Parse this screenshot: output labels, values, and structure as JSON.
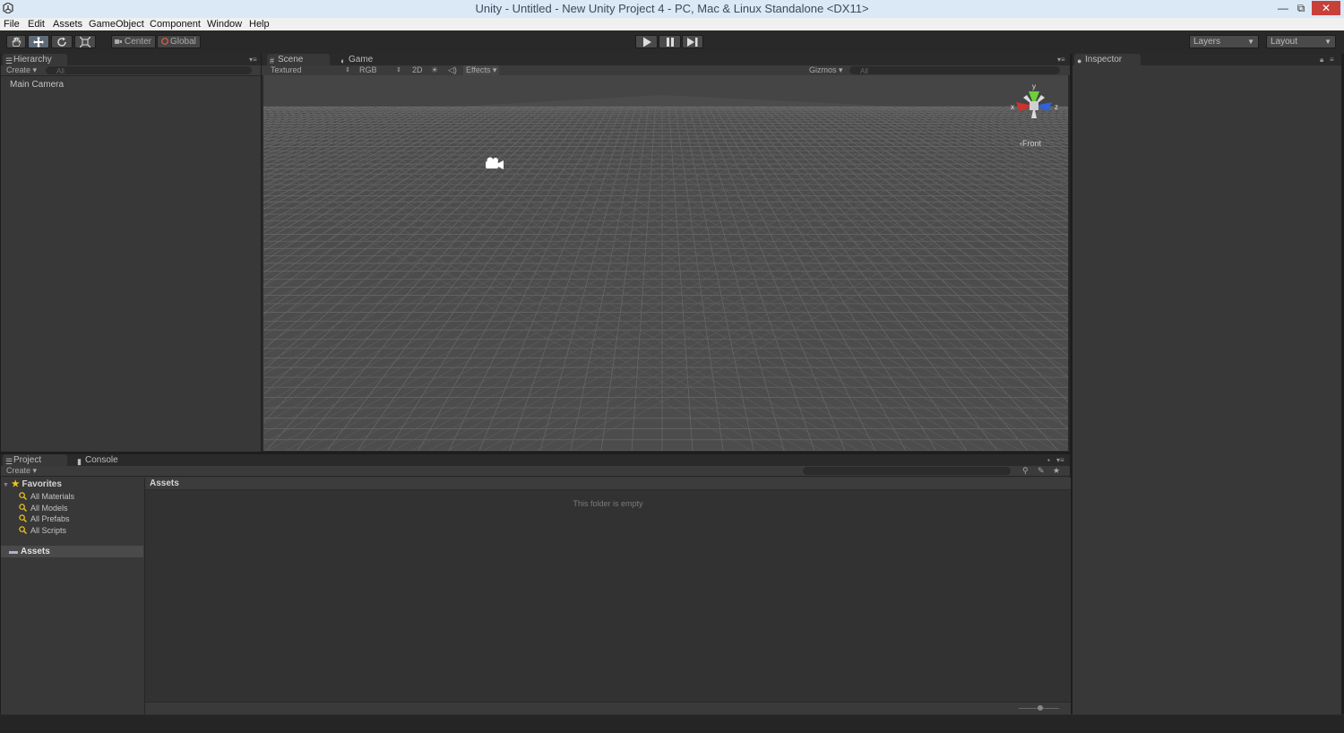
{
  "window": {
    "title": "Unity - Untitled - New Unity Project 4 - PC, Mac & Linux Standalone <DX11>",
    "min_glyph": "—",
    "restore_glyph": "⧉",
    "close_glyph": "✕"
  },
  "menu": [
    "File",
    "Edit",
    "Assets",
    "GameObject",
    "Component",
    "Window",
    "Help"
  ],
  "toolbar": {
    "pivot_mode": "Center",
    "pivot_rotation": "Global",
    "layers_label": "Layers",
    "layout_label": "Layout"
  },
  "hierarchy": {
    "tab": "Hierarchy",
    "create": "Create ▾",
    "search_placeholder": "All",
    "items": [
      "Main Camera"
    ]
  },
  "scene": {
    "tab_scene": "Scene",
    "tab_game": "Game",
    "shading": "Textured",
    "render_mode": "RGB",
    "mode_2d": "2D",
    "effects": "Effects ▾",
    "gizmos": "Gizmos ▾",
    "search_placeholder": "All",
    "gizmo_axes": {
      "y": "y",
      "x": "x",
      "z": "z"
    },
    "view_label": "‹Front"
  },
  "inspector": {
    "tab": "Inspector"
  },
  "project": {
    "tab_project": "Project",
    "tab_console": "Console",
    "create": "Create ▾",
    "favorites_label": "Favorites",
    "favorites": [
      "All Materials",
      "All Models",
      "All Prefabs",
      "All Scripts"
    ],
    "assets_folder": "Assets",
    "breadcrumb": "Assets",
    "empty_message": "This folder is empty"
  },
  "colors": {
    "accent_y": "#6fcf3a",
    "accent_x": "#d0312d",
    "accent_z": "#2f63d6",
    "favorite_star": "#f0c419"
  }
}
